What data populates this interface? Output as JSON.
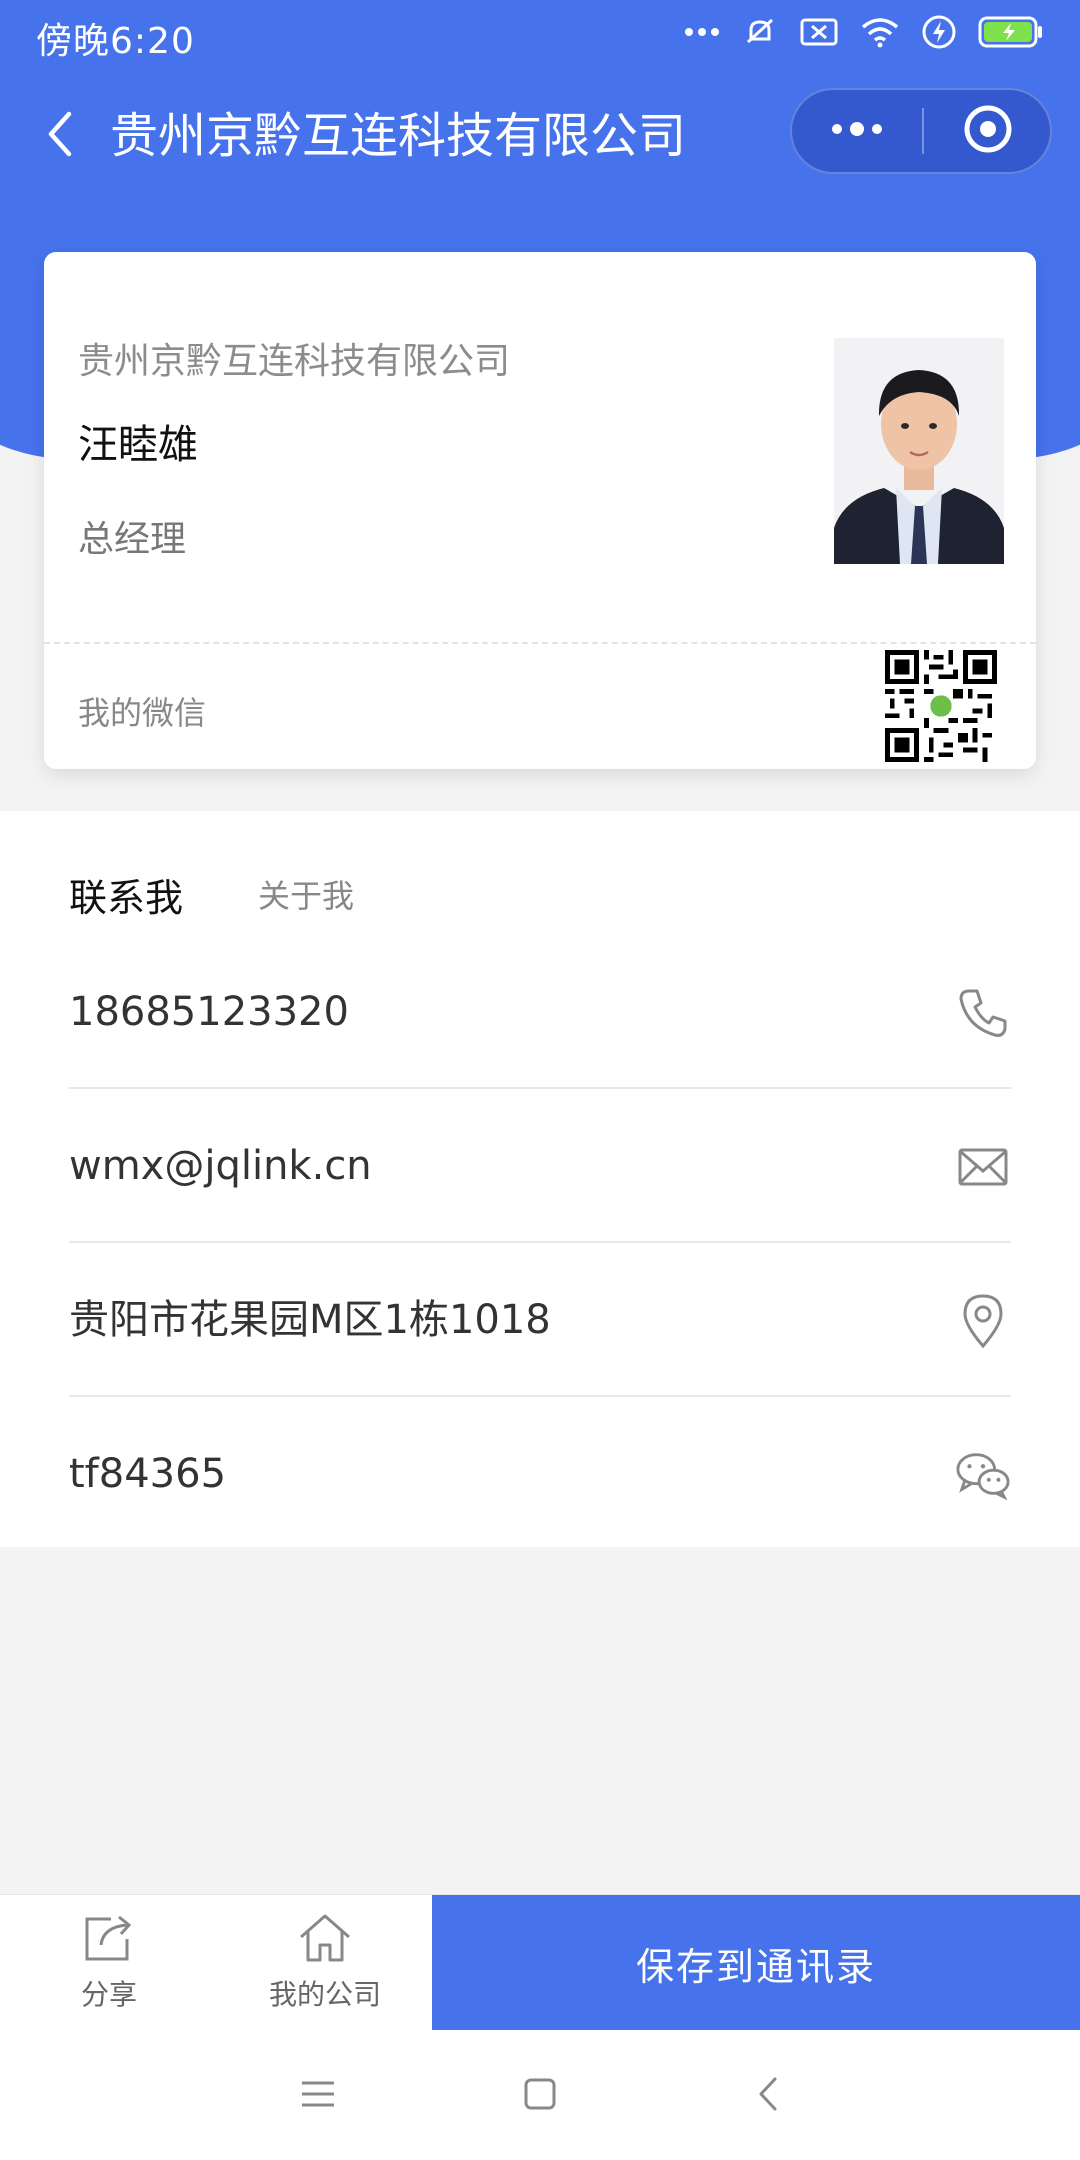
{
  "status_bar": {
    "time": "傍晚6:20",
    "icons": [
      "more-dots-icon",
      "bell-muted-icon",
      "sim-blocked-icon",
      "wifi-icon",
      "charging-icon",
      "battery-icon"
    ]
  },
  "nav": {
    "title": "贵州京黔互连科技有限公司",
    "icons": [
      "back-chevron-icon",
      "more-dots-icon",
      "target-close-icon"
    ]
  },
  "card": {
    "company": "贵州京黔互连科技有限公司",
    "name": "汪睦雄",
    "position": "总经理",
    "wechat_label": "我的微信"
  },
  "tabs": {
    "contact": "联系我",
    "about": "关于我"
  },
  "contact_rows": [
    {
      "text": "18685123320",
      "icon": "phone-icon"
    },
    {
      "text": "wmx@jqlink.cn",
      "icon": "mail-icon"
    },
    {
      "text": "贵阳市花果园M区1栋1018",
      "icon": "location-icon"
    },
    {
      "text": "tf84365",
      "icon": "wechat-icon"
    }
  ],
  "bottom_bar": {
    "share_label": "分享",
    "company_label": "我的公司",
    "save_label": "保存到通讯录"
  },
  "colors": {
    "brand_blue": "#4672ec",
    "background": "#f3f3f3"
  }
}
